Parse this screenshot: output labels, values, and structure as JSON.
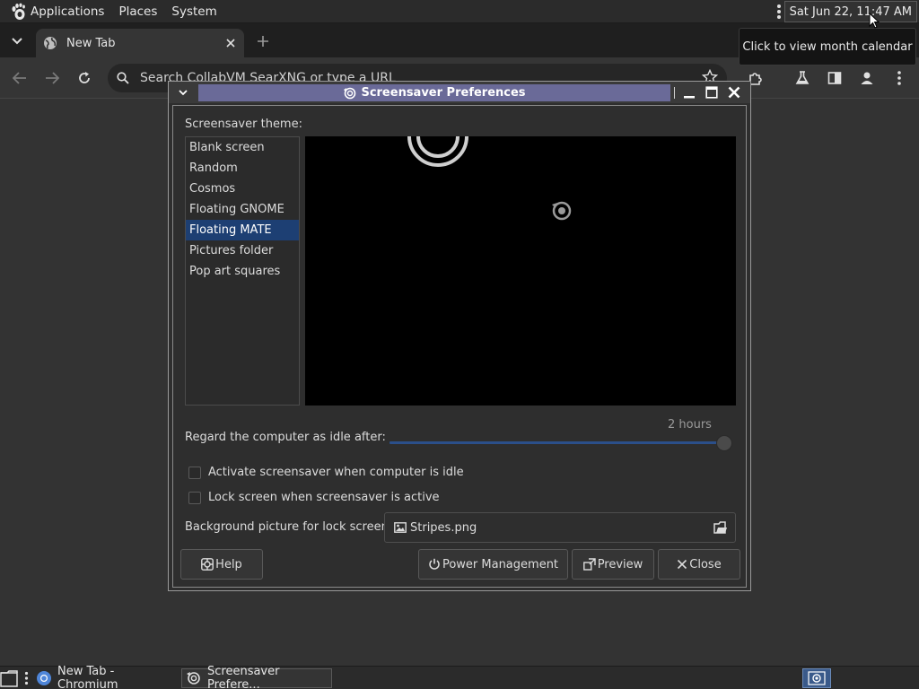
{
  "top_panel": {
    "menus": [
      "Applications",
      "Places",
      "System"
    ],
    "clock": "Sat Jun 22, 11:47 AM",
    "tooltip": "Click to view month calendar"
  },
  "browser": {
    "tab_title": "New Tab",
    "omnibox_placeholder": "Search CollabVM SearXNG or type a URL"
  },
  "dialog": {
    "title": "Screensaver Preferences",
    "theme_label": "Screensaver theme:",
    "themes": [
      "Blank screen",
      "Random",
      "Cosmos",
      "Floating GNOME",
      "Floating MATE",
      "Pictures folder",
      "Pop art squares"
    ],
    "selected_theme": "Floating MATE",
    "idle_label": "Regard the computer as idle after:",
    "idle_value": "2 hours",
    "idle_fraction": 1.0,
    "activate_label": "Activate screensaver when computer is idle",
    "activate_checked": false,
    "lock_label": "Lock screen when screensaver is active",
    "lock_checked": false,
    "bg_label": "Background picture for lock screen:",
    "bg_file": "Stripes.png",
    "buttons": {
      "help": "Help",
      "power": "Power Management",
      "preview": "Preview",
      "close": "Close"
    }
  },
  "taskbar": {
    "tasks": [
      "New Tab - Chromium",
      "Screensaver Prefere..."
    ]
  },
  "colors": {
    "title_bar": "#6a6a98",
    "selection": "#1d3f73",
    "slider": "#2b4f8a"
  }
}
